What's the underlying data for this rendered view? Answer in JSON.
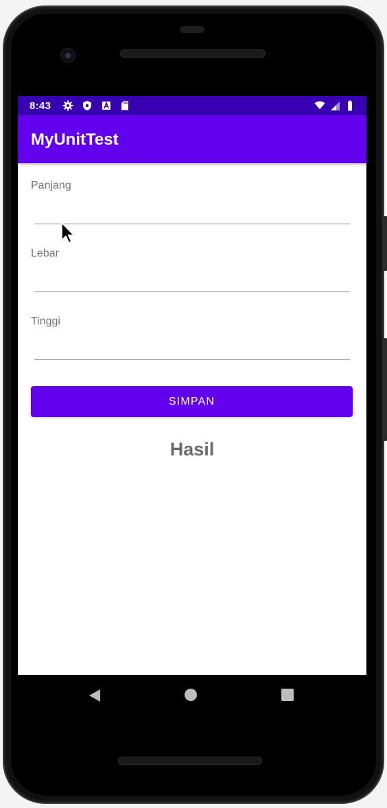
{
  "status_bar": {
    "time": "8:43",
    "left_icons": [
      "gear-icon",
      "shield-icon",
      "a-letter-icon",
      "sd-card-icon"
    ],
    "right_icons": [
      "wifi-icon",
      "signal-icon",
      "battery-icon"
    ]
  },
  "app_bar": {
    "title": "MyUnitTest"
  },
  "form": {
    "fields": [
      {
        "label": "Panjang",
        "value": ""
      },
      {
        "label": "Lebar",
        "value": ""
      },
      {
        "label": "Tinggi",
        "value": ""
      }
    ],
    "save_label": "SIMPAN"
  },
  "result_label": "Hasil",
  "nav_bar": {
    "buttons": [
      "back-icon",
      "home-icon",
      "recent-apps-icon"
    ]
  },
  "colors": {
    "primary": "#6200ee",
    "primary_dark": "#3700b3",
    "label_gray": "#757575"
  }
}
